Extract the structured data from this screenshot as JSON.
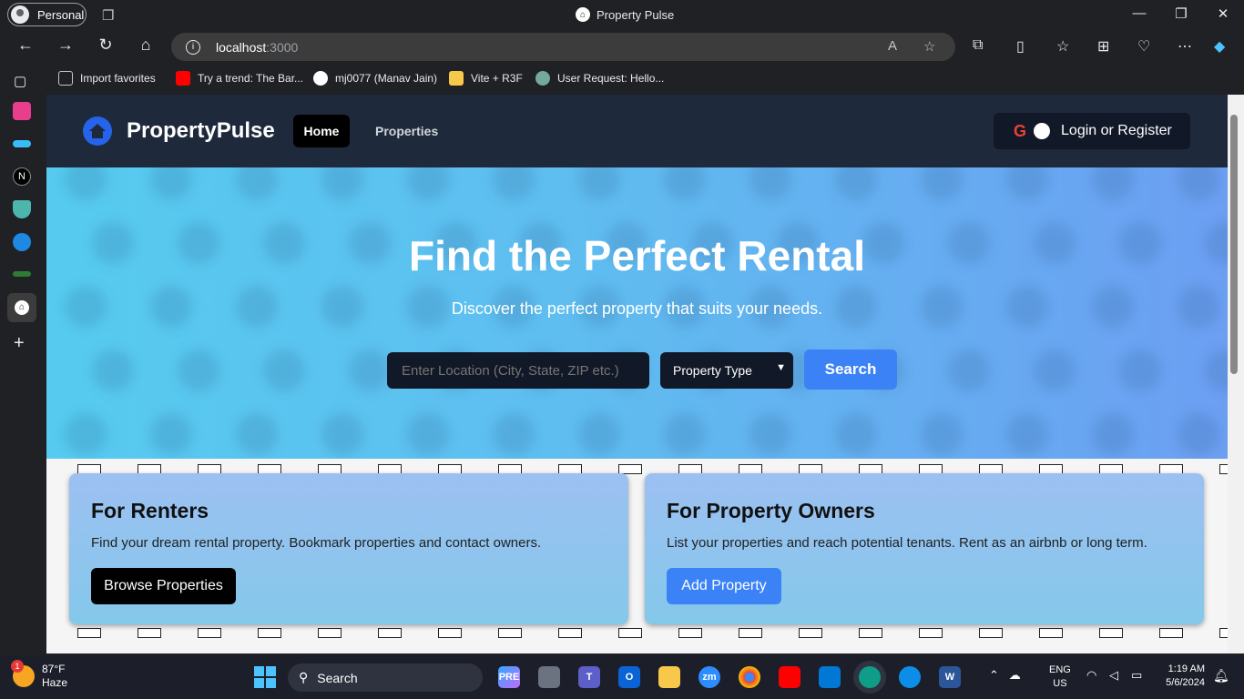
{
  "browser": {
    "profile": "Personal",
    "window_title": "Property Pulse",
    "url_host": "localhost",
    "url_port": ":3000",
    "favorites": [
      {
        "label": "Import favorites"
      },
      {
        "label": "Try a trend: The Bar..."
      },
      {
        "label": "mj0077 (Manav Jain)"
      },
      {
        "label": "Vite + R3F"
      },
      {
        "label": "User Request: Hello..."
      }
    ]
  },
  "site": {
    "brand": "PropertyPulse",
    "nav": {
      "home": "Home",
      "properties": "Properties"
    },
    "login": "Login or Register",
    "hero": {
      "title": "Find the Perfect Rental",
      "subtitle": "Discover the perfect property that suits your needs.",
      "location_placeholder": "Enter Location (City, State, ZIP etc.)",
      "property_type": "Property Type",
      "search": "Search"
    },
    "cards": {
      "renters": {
        "title": "For Renters",
        "text": "Find your dream rental property. Bookmark properties and contact owners.",
        "button": "Browse Properties"
      },
      "owners": {
        "title": "For Property Owners",
        "text": "List your properties and reach potential tenants. Rent as an airbnb or long term.",
        "button": "Add Property"
      }
    },
    "colors": {
      "nav": "#1e293b",
      "accent": "#3b82f6",
      "brand_logo": "#2563eb"
    }
  },
  "taskbar": {
    "weather_temp": "87°F",
    "weather_desc": "Haze",
    "weather_badge": "1",
    "search": "Search",
    "lang_top": "ENG",
    "lang_bottom": "US",
    "time": "1:19 AM",
    "date": "5/6/2024",
    "apps": [
      {
        "label": "PRE"
      },
      {
        "label": ""
      },
      {
        "label": "T"
      },
      {
        "label": "O"
      },
      {
        "label": ""
      },
      {
        "label": "zm"
      },
      {
        "label": ""
      },
      {
        "label": ""
      },
      {
        "label": ""
      },
      {
        "label": ""
      },
      {
        "label": ""
      },
      {
        "label": "W"
      }
    ]
  }
}
